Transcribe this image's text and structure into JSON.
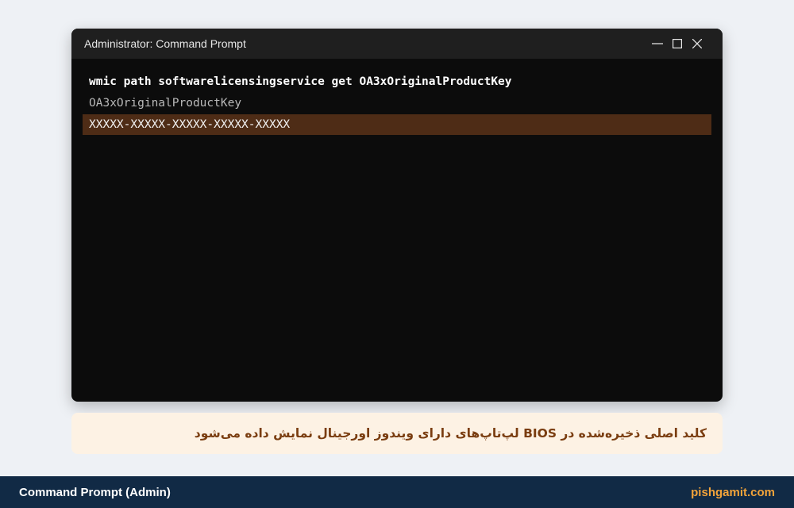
{
  "window": {
    "title": "Administrator: Command Prompt",
    "controls": {
      "minimize_icon": "minimize-icon",
      "maximize_icon": "maximize-icon",
      "close_icon": "close-icon"
    }
  },
  "console": {
    "command": "wmic path softwarelicensingservice get OA3xOriginalProductKey",
    "output_header": "OA3xOriginalProductKey",
    "product_key": "XXXXX-XXXXX-XXXXX-XXXXX-XXXXX"
  },
  "caption": {
    "text": "کلید اصلی ذخیره‌شده در BIOS لپ‌تاپ‌های دارای ویندوز اورجینال نمایش داده می‌شود"
  },
  "footer": {
    "left": "Command Prompt (Admin)",
    "right": "pishgamit.com"
  },
  "colors": {
    "page_bg": "#eef1f5",
    "titlebar_bg": "#1f1f1f",
    "console_bg": "#0c0c0c",
    "highlight_bg": "#4e2c16",
    "caption_bg": "#fdf2e4",
    "caption_text": "#7a3d10",
    "footer_bg": "#112a45",
    "footer_accent": "#f2a33a"
  }
}
